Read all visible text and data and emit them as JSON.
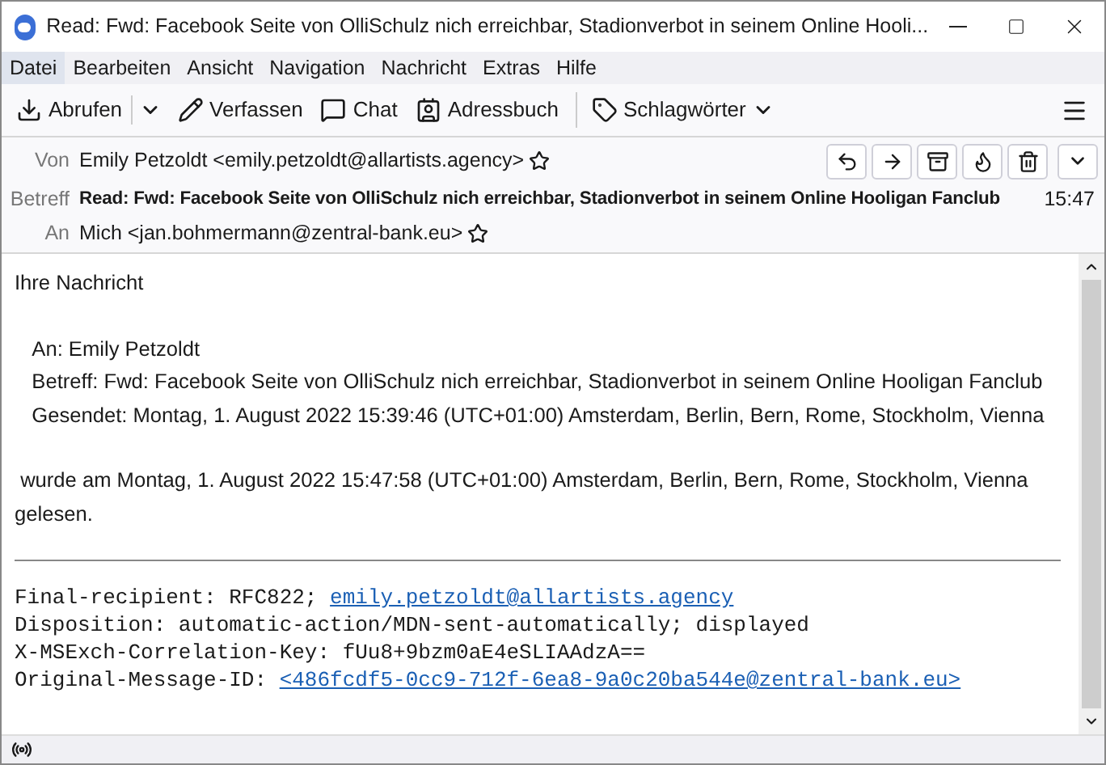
{
  "window": {
    "title": "Read: Fwd: Facebook Seite von OlliSchulz nich erreichbar, Stadionverbot in seinem Online Hooli..."
  },
  "menu": [
    {
      "label": "Datei",
      "selected": true
    },
    {
      "label": "Bearbeiten",
      "selected": false
    },
    {
      "label": "Ansicht",
      "selected": false
    },
    {
      "label": "Navigation",
      "selected": false
    },
    {
      "label": "Nachricht",
      "selected": false
    },
    {
      "label": "Extras",
      "selected": false
    },
    {
      "label": "Hilfe",
      "selected": false
    }
  ],
  "toolbar": [
    {
      "kind": "get",
      "label": "Abrufen"
    },
    {
      "kind": "write",
      "label": "Verfassen"
    },
    {
      "kind": "chat",
      "label": "Chat"
    },
    {
      "kind": "book",
      "label": "Adressbuch"
    },
    {
      "kind": "tags",
      "label": "Schlagwörter"
    }
  ],
  "header": {
    "from_label": "Von",
    "from": "Emily Petzoldt <emily.petzoldt@allartists.agency>",
    "subject_label": "Betreff",
    "subject": "Read: Fwd: Facebook Seite von OlliSchulz nich erreichbar, Stadionverbot in seinem Online Hooligan Fanclub",
    "time": "15:47",
    "to_label": "An",
    "to": "Mich <jan.bohmermann@zentral-bank.eu>"
  },
  "body": {
    "blocks": [
      {
        "lines": [
          "Ihre Nachricht"
        ]
      },
      {
        "lines": [
          "   An: Emily Petzoldt",
          "   Betreff: Fwd: Facebook Seite von OlliSchulz nich erreichbar, Stadionverbot in seinem Online Hooligan Fanclub",
          "   Gesendet: Montag, 1. August 2022 15:39:46 (UTC+01:00) Amsterdam, Berlin, Bern, Rome, Stockholm, Vienna"
        ]
      },
      {
        "lines": [
          " wurde am Montag, 1. August 2022 15:47:58 (UTC+01:00) Amsterdam, Berlin, Bern, Rome, Stockholm, Vienna gelesen."
        ]
      }
    ],
    "report": [
      {
        "key": "Final-recipient: RFC822; ",
        "link": "emily.petzoldt@allartists.agency"
      },
      {
        "key": "Disposition: automatic-action/MDN-sent-automatically; displayed"
      },
      {
        "key": "X-MSExch-Correlation-Key: fUu8+9bzm0aE4eSLIAAdzA=="
      },
      {
        "key": "Original-Message-ID: ",
        "link": "<486fcdf5-0cc9-712f-6ea8-9a0c20ba544e@zentral-bank.eu>"
      }
    ]
  }
}
